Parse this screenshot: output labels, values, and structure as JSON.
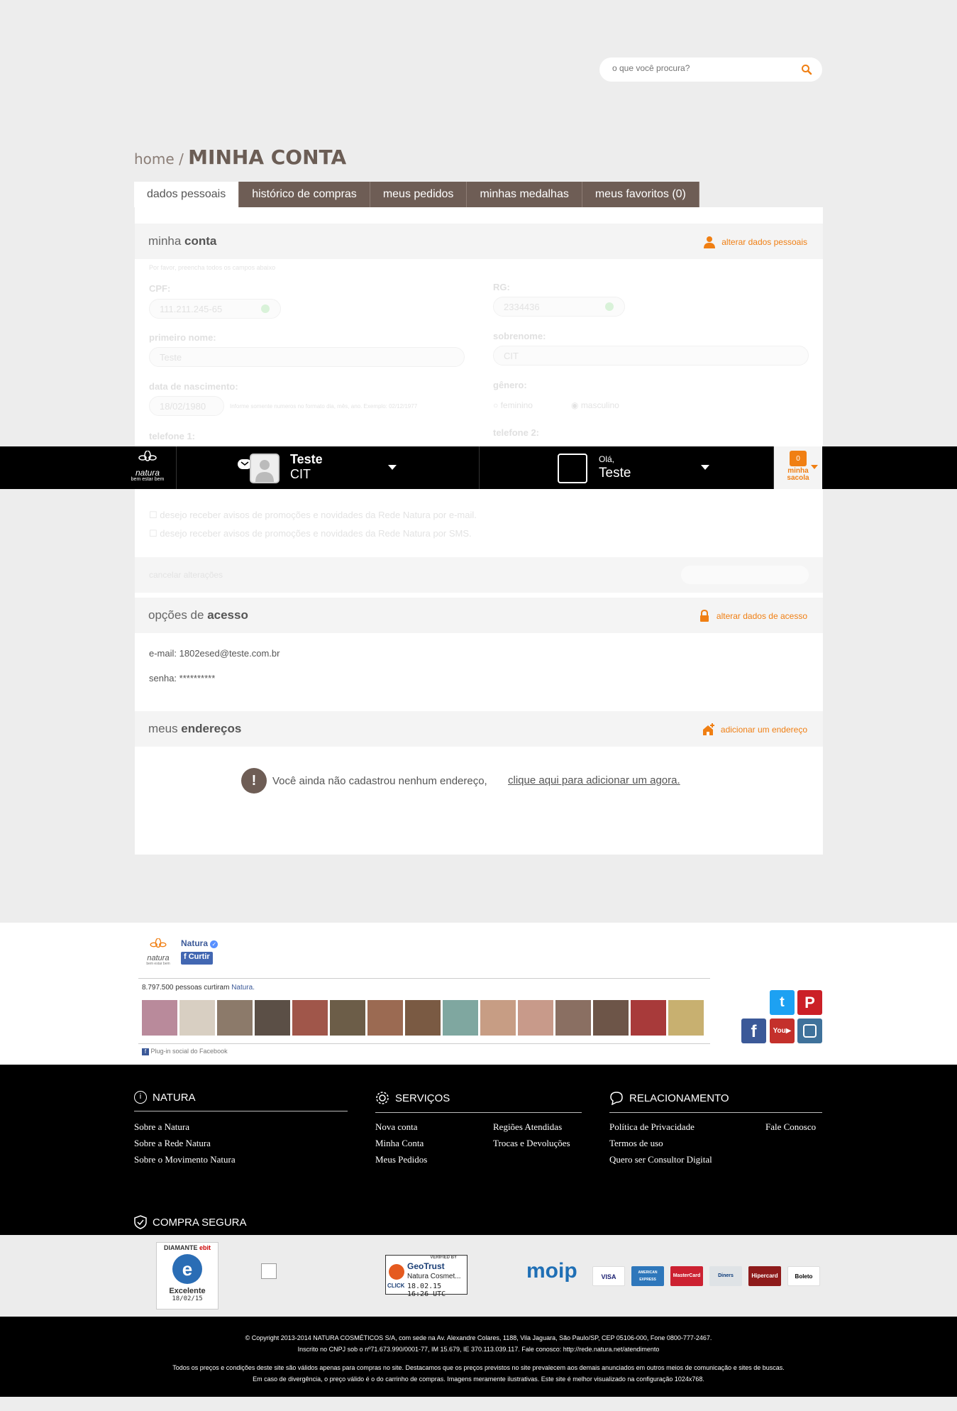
{
  "search": {
    "placeholder": "o que você procura?"
  },
  "breadcrumb": {
    "home": "home",
    "separator": "/",
    "current": "MINHA CONTA"
  },
  "tabs": [
    {
      "label": "dados pessoais"
    },
    {
      "label": "histórico de compras"
    },
    {
      "label": "meus pedidos"
    },
    {
      "label": "minhas medalhas"
    },
    {
      "label": "meus favoritos (0)"
    }
  ],
  "minha_conta": {
    "title_light": "minha ",
    "title_bold": "conta",
    "action": "alterar dados pessoais",
    "note": "Por favor, preencha todos os campos abaixo",
    "cpf_label": "CPF:",
    "cpf_value": "111.211.245-65",
    "rg_label": "RG:",
    "rg_value": "2334436",
    "first_name_label": "primeiro nome:",
    "first_name_value": "Teste",
    "last_name_label": "sobrenome:",
    "last_name_value": "CIT",
    "birth_label": "data de nascimento:",
    "birth_value": "18/02/1980",
    "birth_hint": "Informe somente numeros no formato dia, mês, ano. Exemplo: 02/12/1977",
    "gender_label": "gênero:",
    "gender_f": "feminino",
    "gender_m": "masculino",
    "phone1_label": "telefone 1:",
    "phone2_label": "telefone 2:",
    "opt_email": "desejo receber avisos de promoções e novidades da Rede Natura por e-mail.",
    "opt_sms": "desejo receber avisos de promoções e novidades da Rede Natura por SMS.",
    "cancel": "cancelar alterações"
  },
  "acesso": {
    "title_light": "opções de ",
    "title_bold": "acesso",
    "action": "alterar dados de acesso",
    "email_label": "e-mail:",
    "email_value": "1802esed@teste.com.br",
    "password_label": "senha:",
    "password_value": "**********"
  },
  "enderecos": {
    "title_light": "meus ",
    "title_bold": "endereços",
    "action": "adicionar um endereço",
    "empty_text": "Você ainda não cadastrou nenhum endereço, ",
    "empty_link": "clique aqui para adicionar um agora."
  },
  "bar": {
    "logo_text": "natura",
    "logo_sub": "bem estar bem",
    "consultant_name": "Teste",
    "consultant_sub": "CIT",
    "greeting": "Olá,",
    "user_name": "Teste",
    "bag_count": "0",
    "bag_line1": "minha",
    "bag_line2": "sacola"
  },
  "facebook": {
    "page_name": "Natura",
    "like": "Curtir",
    "count_text": "8.797.500 pessoas curtiram ",
    "count_link": "Natura.",
    "plugin": "Plug-in social do Facebook",
    "logo_text": "natura",
    "logo_sub": "bem estar bem"
  },
  "footer": {
    "natura": {
      "title": "NATURA",
      "links": [
        "Sobre a Natura",
        "Sobre a Rede Natura",
        "Sobre o Movimento Natura"
      ]
    },
    "servicos": {
      "title": "SERVIÇOS",
      "links": [
        "Nova conta",
        "Minha Conta",
        "Meus Pedidos",
        "Regiões Atendidas",
        "Trocas e Devoluções"
      ]
    },
    "relacionamento": {
      "title": "RELACIONAMENTO",
      "links": [
        "Política de Privacidade",
        "Termos de uso",
        "Quero ser Consultor Digital",
        "Fale Conosco"
      ]
    },
    "compra_segura": "COMPRA SEGURA"
  },
  "seals": {
    "ebit_top": "DIAMANTE",
    "ebit_brand": "ebit",
    "ebit_rating": "Excelente",
    "ebit_date": "18/02/15",
    "geotrust_verified": "VERIFIED BY",
    "geotrust_brand": "GeoTrust",
    "geotrust_name": "Natura Cosmet...",
    "geotrust_click": "CLICK",
    "geotrust_date": "18.02.15 16:26 UTC",
    "moip": "moip",
    "cards": [
      "VISA",
      "AMERICAN EXPRESS",
      "MasterCard",
      "Diners",
      "Hipercard",
      "Boleto"
    ]
  },
  "copyright": {
    "line1": "© Copyright 2013-2014 NATURA COSMÉTICOS S/A, com sede na Av. Alexandre Colares, 1188, Vila Jaguara, São Paulo/SP, CEP 05106-000, Fone 0800-777-2467.",
    "line2": "Inscrito no CNPJ sob o nº71.673.990/0001-77, IM 15.679, IE 370.113.039.117. Fale conosco: http://rede.natura.net/atendimento",
    "line3": "Todos os preços e condições deste site são válidos apenas para compras no site. Destacamos que os preços previstos no site prevalecem aos demais anunciados em outros meios de comunicação e sites de buscas.",
    "line4": "Em caso de divergência, o preço válido é o do carrinho de compras. Imagens meramente ilustrativas. Este site é melhor visualizado na configuração 1024x768."
  },
  "colors": {
    "accent": "#f07f13",
    "tab_bg": "#6e5d55",
    "bar_bg": "#000000"
  }
}
